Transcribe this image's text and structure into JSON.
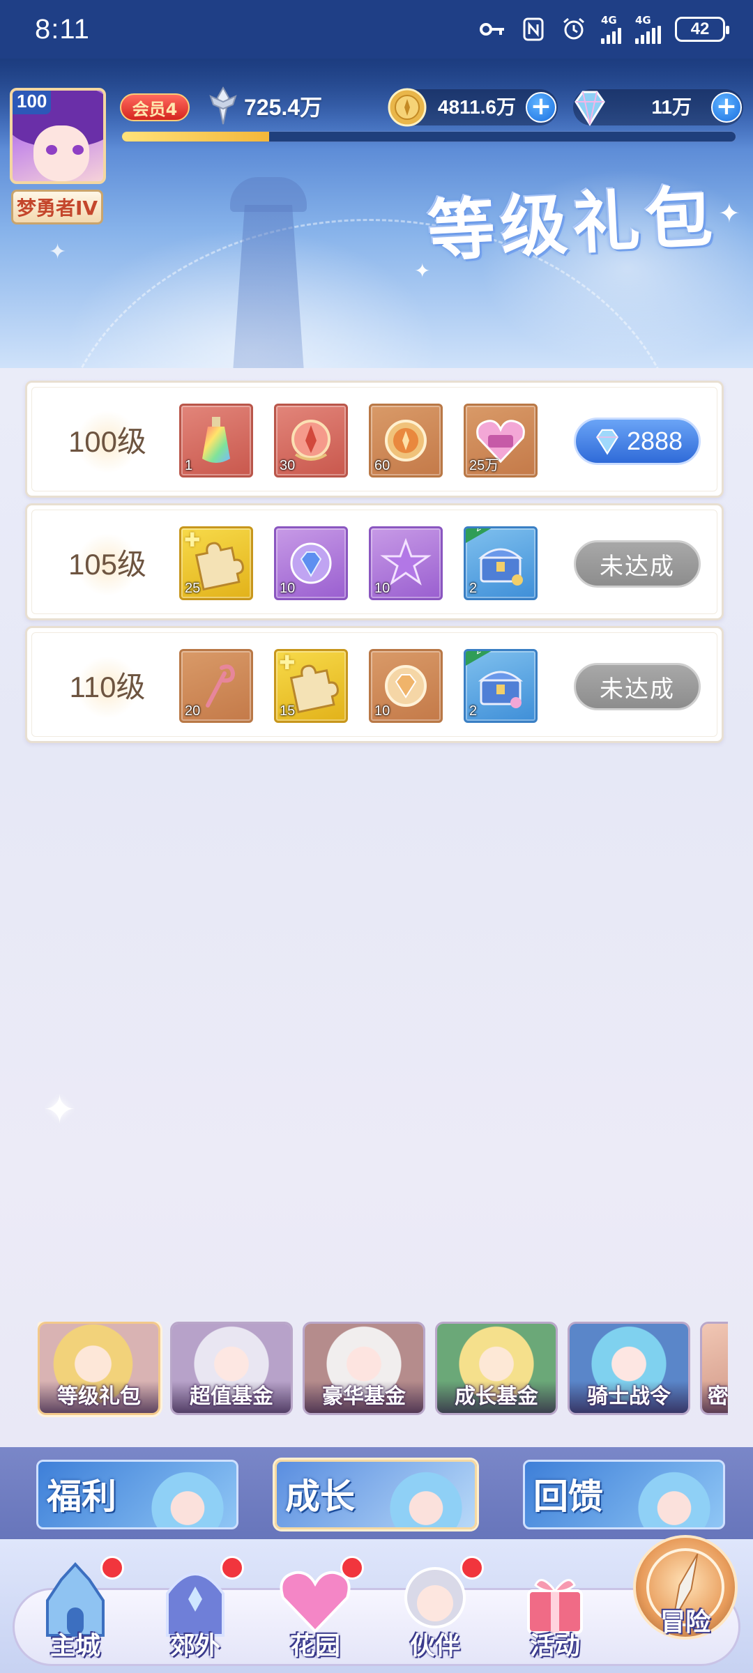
{
  "status_bar": {
    "time": "8:11",
    "network_1": "4G",
    "network_2": "4G",
    "battery": "42"
  },
  "player": {
    "level": "100",
    "title": "梦勇者IV",
    "vip": "会员4",
    "power": "725.4万",
    "exp_progress": 0.24
  },
  "currencies": {
    "gold": "4811.6万",
    "gem": "11万"
  },
  "banner": {
    "title": "等级礼包"
  },
  "rewards": [
    {
      "level": "100级",
      "items": [
        {
          "icon": "rainbow-potion-icon",
          "count": "1"
        },
        {
          "icon": "red-emblem-icon",
          "count": "30"
        },
        {
          "icon": "gold-coin-icon",
          "count": "60"
        },
        {
          "icon": "pink-heart-chest-icon",
          "count": "25万"
        }
      ],
      "action": {
        "type": "buy",
        "value": "2888"
      }
    },
    {
      "level": "105级",
      "items": [
        {
          "icon": "puzzle-piece-icon",
          "count": "25"
        },
        {
          "icon": "blue-gem-icon",
          "count": "10"
        },
        {
          "icon": "purple-star-icon",
          "count": "10"
        },
        {
          "icon": "treasure-chest-icon",
          "count": "2",
          "badge": "2小时"
        }
      ],
      "action": {
        "type": "locked",
        "value": "未达成"
      }
    },
    {
      "level": "110级",
      "items": [
        {
          "icon": "heart-staff-icon",
          "count": "20"
        },
        {
          "icon": "puzzle-piece-icon",
          "count": "15"
        },
        {
          "icon": "gold-gem-icon",
          "count": "10"
        },
        {
          "icon": "treasure-chest-icon",
          "count": "2",
          "badge": "2小时"
        }
      ],
      "action": {
        "type": "locked",
        "value": "未达成"
      }
    }
  ],
  "sub_tabs": [
    "等级礼包",
    "超值基金",
    "豪华基金",
    "成长基金",
    "骑士战令",
    "密"
  ],
  "categories": [
    "福利",
    "成长",
    "回馈"
  ],
  "nav": [
    "主城",
    "郊外",
    "花园",
    "伙伴",
    "活动",
    "冒险"
  ],
  "colors": {
    "accent_blue": "#2f6ad8",
    "status_bar": "#1f3f86",
    "disabled": "#8d8d8d",
    "notify_red": "#f1353d"
  }
}
